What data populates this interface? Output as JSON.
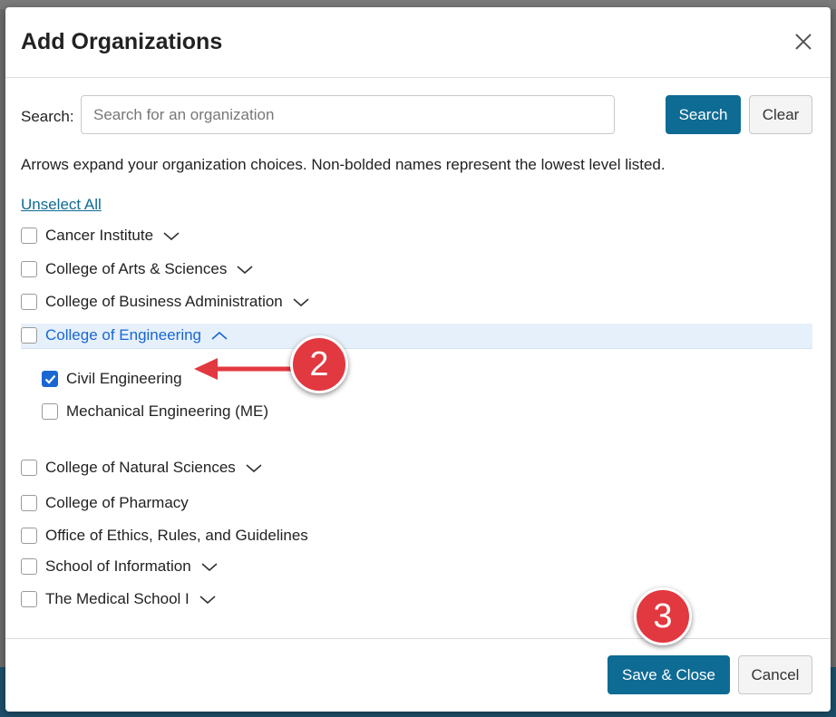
{
  "modal": {
    "title": "Add Organizations"
  },
  "search": {
    "label": "Search:",
    "placeholder": "Search for an organization",
    "value": "",
    "search_button": "Search",
    "clear_button": "Clear"
  },
  "helper_text": "Arrows expand your organization choices. Non-bolded names represent the lowest level listed.",
  "unselect_all": "Unselect All",
  "organizations": [
    {
      "label": "Cancer Institute",
      "checked": false,
      "expandable": true,
      "expanded": false
    },
    {
      "label": "College of Arts & Sciences",
      "checked": false,
      "expandable": true,
      "expanded": false
    },
    {
      "label": "College of Business Administration",
      "checked": false,
      "expandable": true,
      "expanded": false
    },
    {
      "label": "College of Engineering",
      "checked": false,
      "expandable": true,
      "expanded": true,
      "children": [
        {
          "label": "Civil Engineering",
          "checked": true
        },
        {
          "label": "Mechanical Engineering (ME)",
          "checked": false
        }
      ]
    },
    {
      "label": "College of Natural Sciences",
      "checked": false,
      "expandable": true,
      "expanded": false
    },
    {
      "label": "College of Pharmacy",
      "checked": false,
      "expandable": false
    },
    {
      "label": "Office of Ethics, Rules, and Guidelines",
      "checked": false,
      "expandable": false
    },
    {
      "label": "School of Information",
      "checked": false,
      "expandable": true,
      "expanded": false
    },
    {
      "label": "The Medical School I",
      "checked": false,
      "expandable": true,
      "expanded": false
    }
  ],
  "footer": {
    "save_close_button": "Save & Close",
    "cancel_button": "Cancel"
  },
  "annotations": {
    "step_2": "2",
    "step_3": "3",
    "badge_color": "#e2383f"
  },
  "colors": {
    "primary": "#0e6b94",
    "checkbox_checked": "#1a67d2",
    "highlight_row": "#e6f0fb"
  }
}
